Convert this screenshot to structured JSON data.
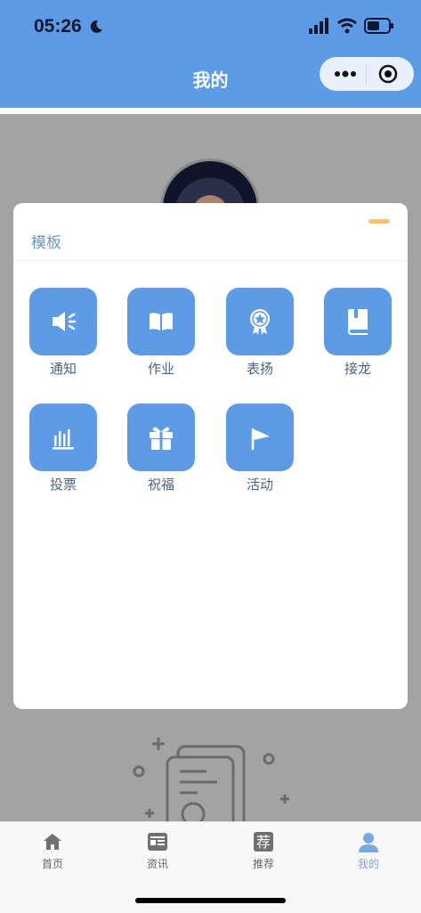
{
  "status_bar": {
    "time": "05:26"
  },
  "nav": {
    "title": "我的"
  },
  "modal": {
    "title": "模板",
    "items": [
      {
        "label": "通知",
        "icon": "megaphone-icon"
      },
      {
        "label": "作业",
        "icon": "book-open-icon"
      },
      {
        "label": "表扬",
        "icon": "award-badge-icon"
      },
      {
        "label": "接龙",
        "icon": "notebook-icon"
      },
      {
        "label": "投票",
        "icon": "bar-chart-icon"
      },
      {
        "label": "祝福",
        "icon": "gift-icon"
      },
      {
        "label": "活动",
        "icon": "flag-icon"
      }
    ]
  },
  "tabbar": {
    "items": [
      {
        "label": "首页",
        "icon": "home-icon"
      },
      {
        "label": "资讯",
        "icon": "news-icon"
      },
      {
        "label": "推荐",
        "icon": "recommend-icon",
        "glyph": "荐"
      },
      {
        "label": "我的",
        "icon": "user-icon",
        "active": true
      }
    ]
  },
  "colors": {
    "primary": "#5d9be6",
    "overlay": "#a3a3a3",
    "accent": "#f4c36a",
    "active_tab": "#79a9e3"
  }
}
